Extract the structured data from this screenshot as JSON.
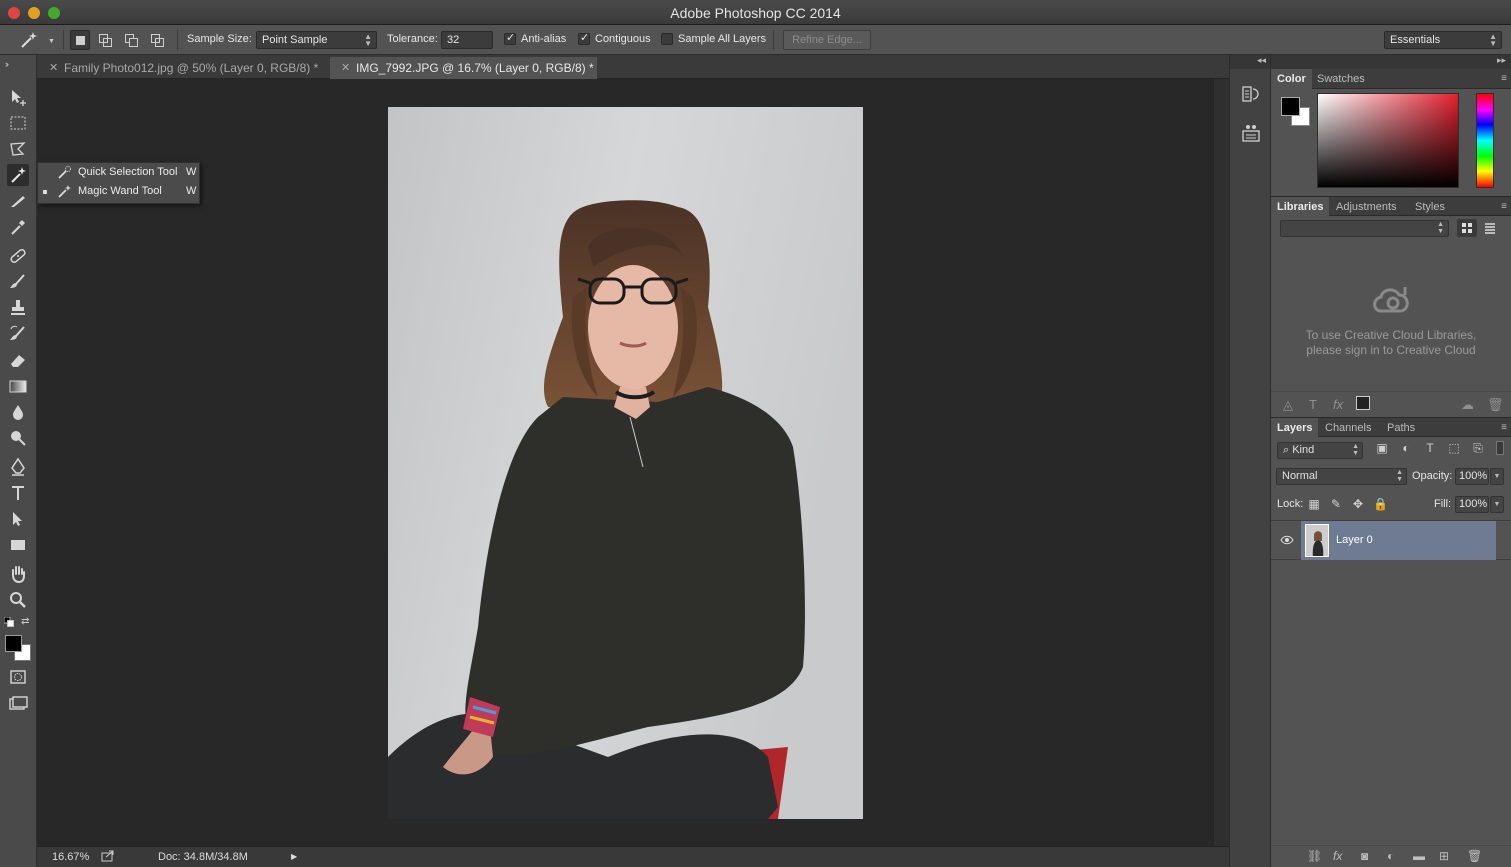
{
  "window": {
    "title": "Adobe Photoshop CC 2014"
  },
  "options_bar": {
    "sample_size_label": "Sample Size:",
    "sample_size_value": "Point Sample",
    "tolerance_label": "Tolerance:",
    "tolerance_value": "32",
    "anti_alias_label": "Anti-alias",
    "anti_alias_checked": true,
    "contiguous_label": "Contiguous",
    "contiguous_checked": true,
    "sample_all_layers_label": "Sample All Layers",
    "sample_all_layers_checked": false,
    "refine_edge_label": "Refine Edge...",
    "workspace_value": "Essentials"
  },
  "tools": [
    "move-tool",
    "marquee-tool",
    "lasso-tool",
    "magic-wand-tool",
    "crop-tool",
    "eyedropper-tool",
    "healing-brush-tool",
    "brush-tool",
    "clone-stamp-tool",
    "history-brush-tool",
    "eraser-tool",
    "gradient-tool",
    "blur-tool",
    "dodge-tool",
    "pen-tool",
    "type-tool",
    "path-selection-tool",
    "rectangle-tool",
    "hand-tool",
    "zoom-tool"
  ],
  "flyout": {
    "items": [
      {
        "label": "Quick Selection Tool",
        "shortcut": "W",
        "selected": false
      },
      {
        "label": "Magic Wand Tool",
        "shortcut": "W",
        "selected": true
      }
    ]
  },
  "doc_tabs": [
    {
      "label": "Family Photo012.jpg @ 50% (Layer 0, RGB/8) *",
      "active": false
    },
    {
      "label": "IMG_7992.JPG @ 16.7% (Layer 0, RGB/8) *",
      "active": true
    }
  ],
  "status": {
    "zoom": "16.67%",
    "doc": "Doc: 34.8M/34.8M"
  },
  "color_panel": {
    "tabs": [
      "Color",
      "Swatches"
    ],
    "foreground": "#000000",
    "background": "#ffffff"
  },
  "libraries_panel": {
    "tabs": [
      "Libraries",
      "Adjustments",
      "Styles"
    ],
    "message_line1": "To use Creative Cloud Libraries,",
    "message_line2": "please sign in to Creative Cloud"
  },
  "layers_panel": {
    "tabs": [
      "Layers",
      "Channels",
      "Paths"
    ],
    "filter_value": "Kind",
    "blend_mode": "Normal",
    "opacity_label": "Opacity:",
    "opacity_value": "100%",
    "lock_label": "Lock:",
    "fill_label": "Fill:",
    "fill_value": "100%",
    "layers": [
      {
        "name": "Layer 0",
        "visible": true,
        "selected": true
      }
    ]
  },
  "colors": {
    "panel_bg": "#535353",
    "canvas_bg": "#282828",
    "selection": "#6e7b92",
    "title_bar": "#3a3a3a"
  }
}
